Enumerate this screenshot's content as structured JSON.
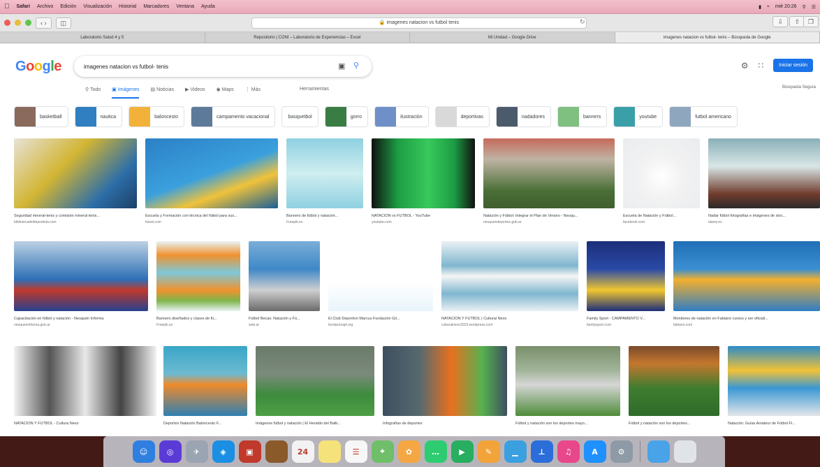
{
  "menubar": {
    "items": [
      "Safari",
      "Archivo",
      "Edición",
      "Visualización",
      "Historial",
      "Marcadores",
      "Ventana",
      "Ayuda"
    ],
    "clock": "mié 20:26"
  },
  "toolbar": {
    "url": "🔒 imagenes natacion vs futbol tenis"
  },
  "tabs": [
    "Laboratorio Salud 4 y 5",
    "Repositorio | CONI – Laboratorio de Experiencias – Excel",
    "Mi Unidad – Google Drive",
    "imagenes natacion vs futbol- tenis – Búsqueda de Google"
  ],
  "google": {
    "logo": "Google",
    "query": "imagenes natacion vs futbol- tenis",
    "signin_label": "Iniciar sesión",
    "safe_search": "Búsqueda Segura",
    "nav": [
      "Todo",
      "Imágenes",
      "Noticias",
      "Videos",
      "Maps",
      "Más",
      "Herramientas"
    ]
  },
  "chips": [
    {
      "label": "basketball",
      "color": "#8a6a5c"
    },
    {
      "label": "nautica",
      "color": "#2f7fc1"
    },
    {
      "label": "baloncesto",
      "color": "#f2b23a"
    },
    {
      "label": "campamento vacacional",
      "color": "#5e7a9a"
    },
    {
      "label": "basquetbol",
      "color": ""
    },
    {
      "label": "gorro",
      "color": "#3a7d44"
    },
    {
      "label": "ilustración",
      "color": "#6f8fc8"
    },
    {
      "label": "deportivas",
      "color": "#d9d9d9"
    },
    {
      "label": "nadadores",
      "color": "#4b5b6b"
    },
    {
      "label": "banners",
      "color": "#7fbf7f"
    },
    {
      "label": "youtube",
      "color": "#3aa0a8"
    },
    {
      "label": "futbol americano",
      "color": "#8fa6bf"
    }
  ],
  "row1": [
    {
      "cap": "Seguridad mineral-tenis y comisión mineral tenis...",
      "src": "bibliotecadeldeportista.com",
      "bg": "linear-gradient(135deg,#e7e2d6 0%,#d2b533 40%,#2d6ea8 75%,#1b3f66 100%)"
    },
    {
      "cap": "Escuela y Formación con técnica del fútbol para sus...",
      "src": "futsal.com",
      "bg": "linear-gradient(160deg,#2c80c6 0%,#3aa0dd 50%,#f0c23a 70%,#1a5f96 100%)"
    },
    {
      "cap": "Banners de fútbol y natación...",
      "src": "Freepik.es",
      "bg": "linear-gradient(180deg,#8fd0e0 0%,#cfeef0 50%,#8fd0e0 100%)"
    },
    {
      "cap": "NATACIÓN vs FUTBOL - YouTube",
      "src": "youtube.com",
      "bg": "linear-gradient(90deg,#111 0%,#1c9c43 25%,#38c95c 55%,#1c9c43 80%,#111 100%)"
    },
    {
      "cap": "Natación y Fútbol: Integrar el Plan de Verano - Neuqu...",
      "src": "neuquendeportes.gob.ar",
      "bg": "linear-gradient(180deg,#c66a5a 0%,#bfb3a3 30%,#4a6f36 75%,#3f5e2e 100%)"
    },
    {
      "cap": "Escuela de Natación y Fútbol...",
      "src": "facebook.com",
      "bg": "radial-gradient(circle at 50% 55%,#ffffff 0%,#f2f2f2 40%,#e9ecef 100%)"
    },
    {
      "cap": "Nadar fútbol fotografías e imágenes de stoc...",
      "src": "alamy.es",
      "bg": "linear-gradient(180deg,#8ab0b8 0%,#d8e6e6 40%,#6f3b2c 80%,#2b2b2b 100%)"
    }
  ],
  "row2": [
    {
      "cap": "Capacitación en fútbol y natación - Neuquén Informa",
      "src": "neuqueninforma.gob.ar",
      "bg": "linear-gradient(180deg,#bcd1e4 0%,#2d6fb6 55%,#c0392b 70%,#27408f 100%)"
    },
    {
      "cap": "Banners diseñados y clases de fú...",
      "src": "Freepik.es",
      "bg": "linear-gradient(180deg,#e8f3f5 0%,#f0922f 20%,#7ec8d8 45%,#f0922f 70%,#7fb54a 85%,#e8f3f5 100%)"
    },
    {
      "cap": "Fútbol Becas: Natación y Fú...",
      "src": "web.ar",
      "bg": "linear-gradient(180deg,#7aaed8 0%,#3f88c7 40%,#cfcfcf 70%,#6a6a6a 100%)"
    },
    {
      "cap": "El Club Deportivo Marcus Fundación Gil...",
      "src": "fundaciongil.org",
      "bg": "linear-gradient(180deg,#ffffff 0%,#ffffff 60%,#e8f4fb 100%)"
    },
    {
      "cap": "NATACIÓN Y FUTBOL | Cultural Nexo",
      "src": "culturalnexo2019.wordpress.com",
      "bg": "linear-gradient(180deg,#e9f1f4 0%,#7fb6cf 35%,#f5f5f5 50%,#7fb6cf 75%,#e9f1f4 100%)"
    },
    {
      "cap": "Family Sport - CAMPAMENTO V...",
      "src": "familysport.com",
      "bg": "linear-gradient(180deg,#1c2e7a 0%,#2a4aa6 40%,#f2c72e 70%,#1c2e7a 100%)"
    },
    {
      "cap": "Monitores de natación en Fabiano cursos y ser oficiali...",
      "src": "fabiano.com",
      "bg": "linear-gradient(180deg,#1f6fb6 0%,#3a8fd1 40%,#f2b02e 55%,#2f7dc4 100%)"
    }
  ],
  "row3": [
    {
      "cap": "NATACIÓN Y FUTBOL - Cultura Nexo",
      "src": "",
      "bg": "linear-gradient(90deg,#f2f2f2 0%,#555 25%,#e8e8e8 50%,#444 75%,#f2f2f2 100%)"
    },
    {
      "cap": "Deportes Natación Baloncesto F...",
      "src": "",
      "bg": "linear-gradient(180deg,#3aa6c7 0%,#6dbad1 40%,#ef8a2c 55%,#2f7fb2 100%)"
    },
    {
      "cap": "Imágenes fútbol y natación | El Heraldo del Balb...",
      "src": "",
      "bg": "linear-gradient(180deg,#6b7b6a 0%,#7b8a7c 40%,#3d8b3d 70%,#4e9f45 100%)"
    },
    {
      "cap": "Infografías de deportes",
      "src": "",
      "bg": "linear-gradient(90deg,#3d4f5f 0%,#57696f 30%,#e8701f 55%,#57b14f 80%,#3d4f5f 100%)"
    },
    {
      "cap": "Fútbol y natación son los deportes mayo...",
      "src": "",
      "bg": "linear-gradient(180deg,#7a8f6b 0%,#a2b59a 35%,#d6d6d6 55%,#4e8c3a 100%)"
    },
    {
      "cap": "Fútbol y natación son los deportes...",
      "src": "",
      "bg": "linear-gradient(180deg,#7a4a2a 0%,#c4772e 25%,#3e7d2f 60%,#2f6b2a 100%)"
    },
    {
      "cap": "Natación: Guías Amateur de Fútbol Fl...",
      "src": "",
      "bg": "linear-gradient(180deg,#2c8bc9 0%,#f2c236 35%,#3a97d3 60%,#e3e6ea 100%)"
    }
  ],
  "dock": [
    {
      "name": "finder",
      "color": "#2f7fe0",
      "glyph": "☺"
    },
    {
      "name": "siri",
      "color": "#5b3bd6",
      "glyph": "◎"
    },
    {
      "name": "launchpad",
      "color": "#9aa4b2",
      "glyph": "✈"
    },
    {
      "name": "safari",
      "color": "#1a8fe3",
      "glyph": "◈"
    },
    {
      "name": "photo-booth",
      "color": "#c0392b",
      "glyph": "▣"
    },
    {
      "name": "notes-brown",
      "color": "#8b5a2b",
      "glyph": ""
    },
    {
      "name": "calendar",
      "color": "#f2f2f2",
      "glyph": "24"
    },
    {
      "name": "stickies",
      "color": "#f6e27a",
      "glyph": ""
    },
    {
      "name": "reminders",
      "color": "#f7f7f7",
      "glyph": "☰"
    },
    {
      "name": "maps",
      "color": "#6fbf6a",
      "glyph": "⌖"
    },
    {
      "name": "photos",
      "color": "#f4a742",
      "glyph": "✿"
    },
    {
      "name": "messages",
      "color": "#2ecc71",
      "glyph": "…"
    },
    {
      "name": "facetime",
      "color": "#27ae60",
      "glyph": "▶"
    },
    {
      "name": "pages",
      "color": "#f2a33a",
      "glyph": "✎"
    },
    {
      "name": "numbers",
      "color": "#3aa0e0",
      "glyph": "▁"
    },
    {
      "name": "keynote",
      "color": "#2b6ed9",
      "glyph": "⊥"
    },
    {
      "name": "itunes",
      "color": "#e8488a",
      "glyph": "♫"
    },
    {
      "name": "app-store",
      "color": "#1e90ff",
      "glyph": "A"
    },
    {
      "name": "system-preferences",
      "color": "#8e9aa6",
      "glyph": "⚙"
    },
    {
      "name": "downloads-folder",
      "color": "#4aa3e8",
      "glyph": ""
    },
    {
      "name": "trash",
      "color": "#e0e3e8",
      "glyph": ""
    }
  ]
}
